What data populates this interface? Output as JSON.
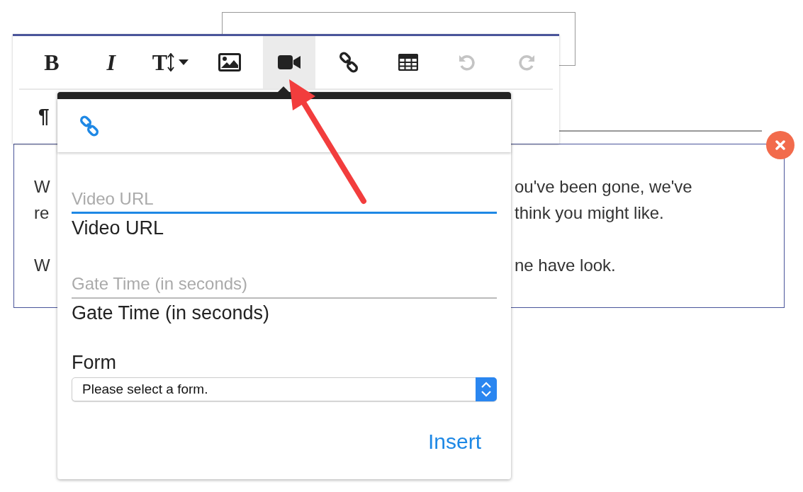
{
  "toolbar": {
    "rows": [
      [
        {
          "kind": "bold",
          "label": "B",
          "selected": false,
          "disabled": false
        },
        {
          "kind": "italic",
          "label": "I",
          "selected": false,
          "disabled": false
        },
        {
          "kind": "text-size",
          "label": "T",
          "selected": false,
          "disabled": false
        },
        {
          "kind": "image",
          "selected": false,
          "disabled": false
        },
        {
          "kind": "video",
          "selected": true,
          "disabled": false
        },
        {
          "kind": "link",
          "selected": false,
          "disabled": false
        },
        {
          "kind": "table",
          "selected": false,
          "disabled": false
        },
        {
          "kind": "undo",
          "selected": false,
          "disabled": true
        },
        {
          "kind": "redo",
          "selected": false,
          "disabled": true
        }
      ],
      [
        {
          "kind": "paragraph",
          "label": "¶",
          "selected": false,
          "disabled": false
        }
      ]
    ]
  },
  "editor": {
    "paragraphs": [
      [
        {
          "left": "W",
          "right": "ou've been gone, we've"
        },
        {
          "left": "re",
          "right": "think you might like."
        }
      ],
      [
        {
          "left": "W",
          "right": "ne have look."
        }
      ]
    ]
  },
  "video_popup": {
    "tabs": [
      {
        "kind": "link",
        "selected": true
      }
    ],
    "fields": [
      {
        "kind": "text",
        "placeholder": "Video URL",
        "focused": true,
        "label": "Video URL"
      },
      {
        "kind": "text",
        "placeholder": "Gate Time (in seconds)",
        "focused": false,
        "label": "Gate Time (in seconds)"
      },
      {
        "kind": "select",
        "label": "Form",
        "value": "Please select a form."
      }
    ],
    "insert_button": "Insert"
  }
}
